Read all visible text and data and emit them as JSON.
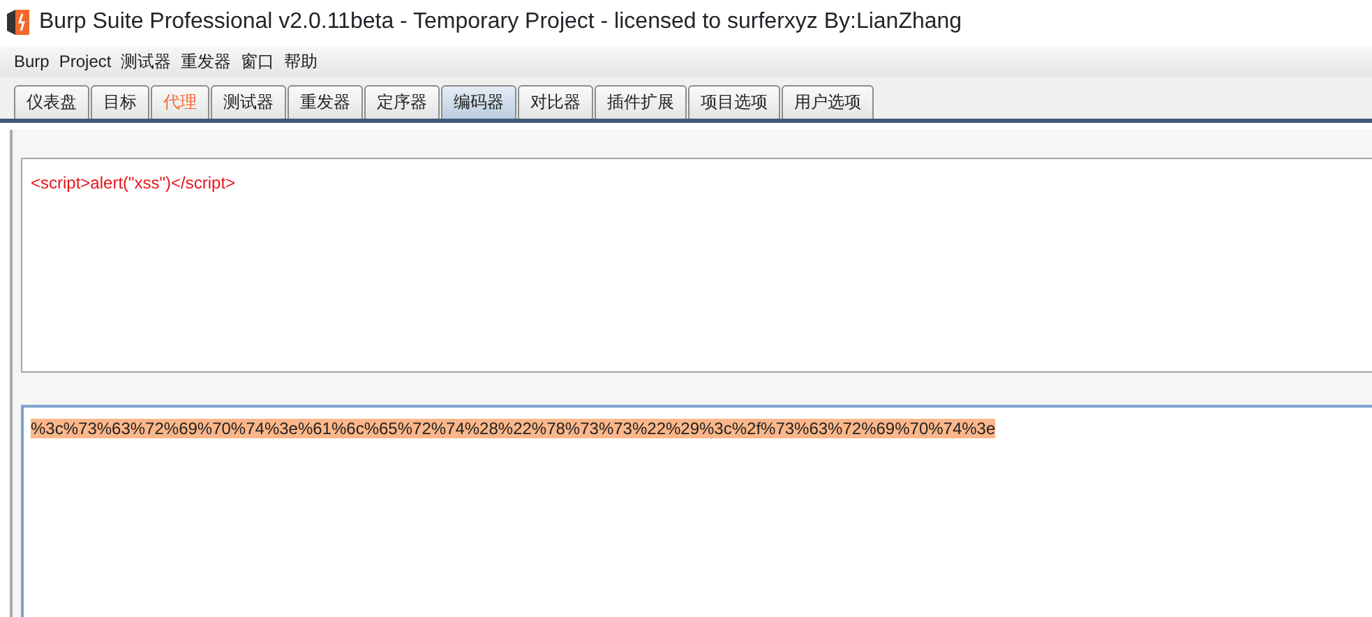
{
  "window": {
    "title": "Burp Suite Professional v2.0.11beta - Temporary Project - licensed to surferxyz By:LianZhang"
  },
  "menu": [
    "Burp",
    "Project",
    "测试器",
    "重发器",
    "窗口",
    "帮助"
  ],
  "tabs": [
    {
      "label": "仪表盘",
      "selected": false,
      "highlighted": false
    },
    {
      "label": "目标",
      "selected": false,
      "highlighted": false
    },
    {
      "label": "代理",
      "selected": false,
      "highlighted": true
    },
    {
      "label": "测试器",
      "selected": false,
      "highlighted": false
    },
    {
      "label": "重发器",
      "selected": false,
      "highlighted": false
    },
    {
      "label": "定序器",
      "selected": false,
      "highlighted": false
    },
    {
      "label": "编码器",
      "selected": true,
      "highlighted": false
    },
    {
      "label": "对比器",
      "selected": false,
      "highlighted": false
    },
    {
      "label": "插件扩展",
      "selected": false,
      "highlighted": false
    },
    {
      "label": "项目选项",
      "selected": false,
      "highlighted": false
    },
    {
      "label": "用户选项",
      "selected": false,
      "highlighted": false
    }
  ],
  "input_panel": {
    "text": "<script>alert(\"xss\")</script>"
  },
  "output_panel": {
    "text": "%3c%73%63%72%69%70%74%3e%61%6c%65%72%74%28%22%78%73%73%22%29%3c%2f%73%63%72%69%70%74%3e",
    "selected": true
  }
}
